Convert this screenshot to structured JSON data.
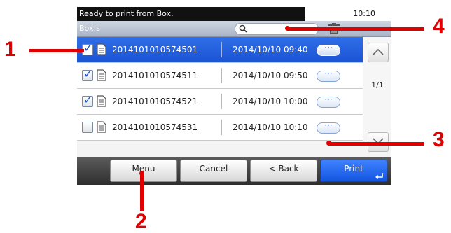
{
  "status_bar": {
    "message": "Ready to print from Box.",
    "time": "10:10"
  },
  "title_bar": {
    "title": "Box:s"
  },
  "files": [
    {
      "name": "2014101010574501",
      "date": "2014/10/10 09:40",
      "checked": true,
      "selected": true
    },
    {
      "name": "2014101010574511",
      "date": "2014/10/10 09:50",
      "checked": true,
      "selected": false
    },
    {
      "name": "2014101010574521",
      "date": "2014/10/10 10:00",
      "checked": true,
      "selected": false
    },
    {
      "name": "2014101010574531",
      "date": "2014/10/10 10:10",
      "checked": false,
      "selected": false
    }
  ],
  "pager": {
    "page": "1/1"
  },
  "buttons": {
    "menu": "Menu",
    "cancel": "Cancel",
    "back": "< Back",
    "print": "Print"
  },
  "callouts": [
    "1",
    "2",
    "3",
    "4"
  ],
  "colors": {
    "selection": "#1b53d4",
    "print_button": "#1455e0",
    "callout": "#e00000"
  }
}
